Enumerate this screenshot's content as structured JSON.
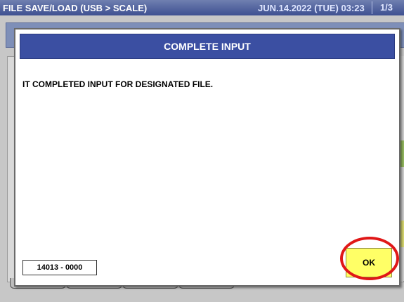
{
  "statusbar": {
    "title": "FILE SAVE/LOAD (USB > SCALE)",
    "datetime": "JUN.14.2022 (TUE)  03:23",
    "page": "1/3"
  },
  "dialog": {
    "title": "COMPLETE INPUT",
    "message": "IT COMPLETED INPUT FOR DESIGNATED FILE.",
    "code": "14013 - 0000",
    "ok_label": "OK"
  },
  "colors": {
    "header_blue": "#3b4fa2",
    "ok_yellow": "#ffff66",
    "highlight_red": "#e01818"
  }
}
